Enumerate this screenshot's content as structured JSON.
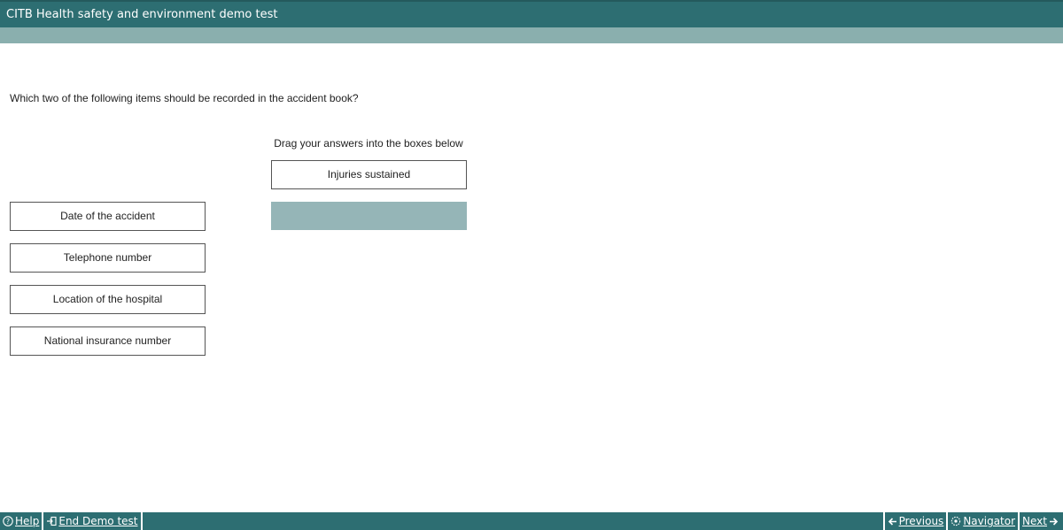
{
  "app": {
    "title": "CITB Health safety and environment demo test"
  },
  "question": {
    "text": "Which two of the following items should be recorded in the accident book?",
    "instruction": "Drag your answers into the boxes below"
  },
  "answer_boxes": [
    {
      "label": "Injuries sustained"
    },
    {
      "label": ""
    }
  ],
  "options": [
    {
      "label": "Date of the accident"
    },
    {
      "label": "Telephone number"
    },
    {
      "label": "Location of the hospital"
    },
    {
      "label": "National insurance number"
    }
  ],
  "footer": {
    "help_label": "Help",
    "end_label": "End Demo test",
    "previous_label": "Previous",
    "navigator_label": "Navigator",
    "next_label": "Next"
  },
  "colors": {
    "header": "#2d6e72",
    "subheader": "#8aafae",
    "empty_drop": "#95b5b7"
  }
}
